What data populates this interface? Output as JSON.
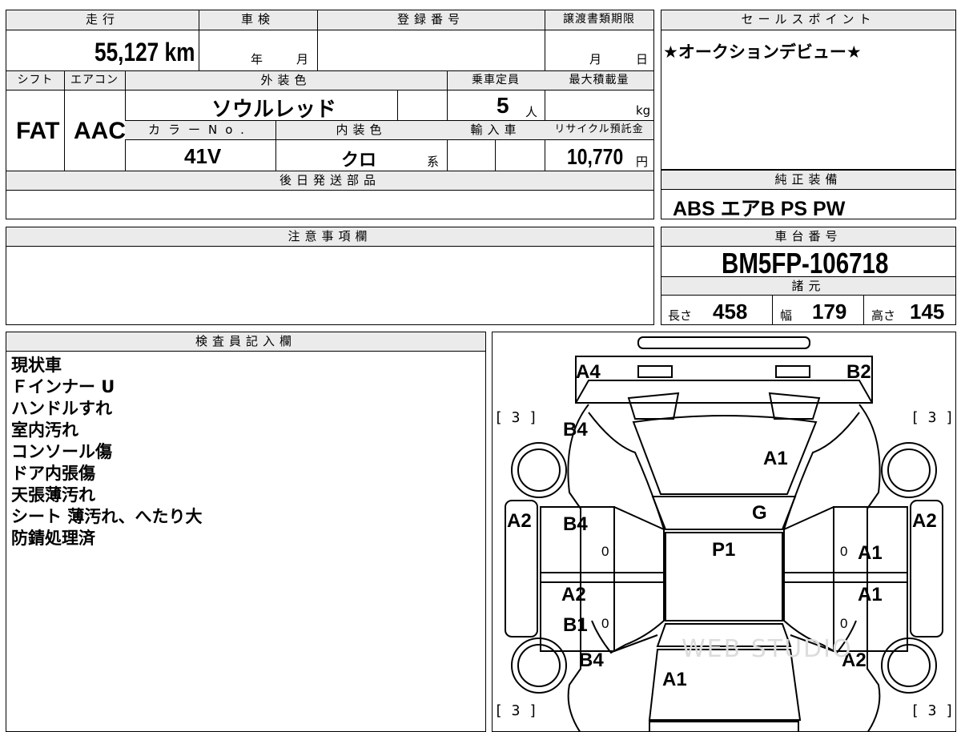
{
  "specs": {
    "mileage_header": "走行",
    "mileage_value": "55,127 km",
    "inspection_header": "車検",
    "inspection_year_unit": "年",
    "inspection_month_unit": "月",
    "registration_header": "登録番号",
    "transfer_header": "譲渡書類期限",
    "transfer_month_unit": "月",
    "transfer_day_unit": "日",
    "shift_header": "シフト",
    "shift_value": "FAT",
    "ac_header": "エアコン",
    "ac_value": "AAC",
    "exterior_color_header": "外装色",
    "exterior_color_value": "ソウルレッド",
    "capacity_header": "乗車定員",
    "capacity_value": "5",
    "capacity_unit": "人",
    "max_load_header": "最大積載量",
    "max_load_unit": "kg",
    "color_no_header": "カラーNo.",
    "color_no_value": "41V",
    "interior_color_header": "内装色",
    "interior_color_value": "クロ",
    "interior_color_suffix": "系",
    "import_header": "輸入車",
    "recycle_header": "リサイクル預託金",
    "recycle_value": "10,770",
    "recycle_unit": "円",
    "later_parts_header": "後日発送部品"
  },
  "sales": {
    "header": "セールスポイント",
    "text": "★オークションデビュー★"
  },
  "equipment": {
    "header": "純正装備",
    "items": "ABS エアB PS PW"
  },
  "notes": {
    "header": "注意事項欄"
  },
  "chassis": {
    "header": "車台番号",
    "value": "BM5FP-106718",
    "dims_header": "諸元",
    "length_label": "長さ",
    "length_value": "458",
    "width_label": "幅",
    "width_value": "179",
    "height_label": "高さ",
    "height_value": "145"
  },
  "inspector": {
    "header": "検査員記入欄",
    "lines": [
      "現状車",
      "Ｆインナー U",
      "ハンドルすれ",
      "室内汚れ",
      "コンソール傷",
      "ドア内張傷",
      "天張薄汚れ",
      "シート 薄汚れ、へたり大",
      "防錆処理済"
    ]
  },
  "diagram": {
    "marks": {
      "front_left_corner": "A4",
      "front_right_corner": "B2",
      "left_fender": "B4",
      "hood": "A1",
      "windshield": "G",
      "left_front_door": "B4",
      "roof": "P1",
      "right_front_door": "A1",
      "left_rear_door_1": "A2",
      "left_rear_door_2": "B1",
      "right_rear_door": "A1",
      "left_rear_fender": "B4",
      "trunk": "A1",
      "right_rear_fender": "A2",
      "left_side": "A2",
      "right_side": "A2"
    },
    "tire_marks": [
      "[ 3 ]",
      "[ 3 ]",
      "[ 3 ]",
      "[ 3 ]"
    ],
    "zero_marks": [
      "0",
      "0",
      "0",
      "0"
    ],
    "watermark": "WEB STUDIO"
  }
}
